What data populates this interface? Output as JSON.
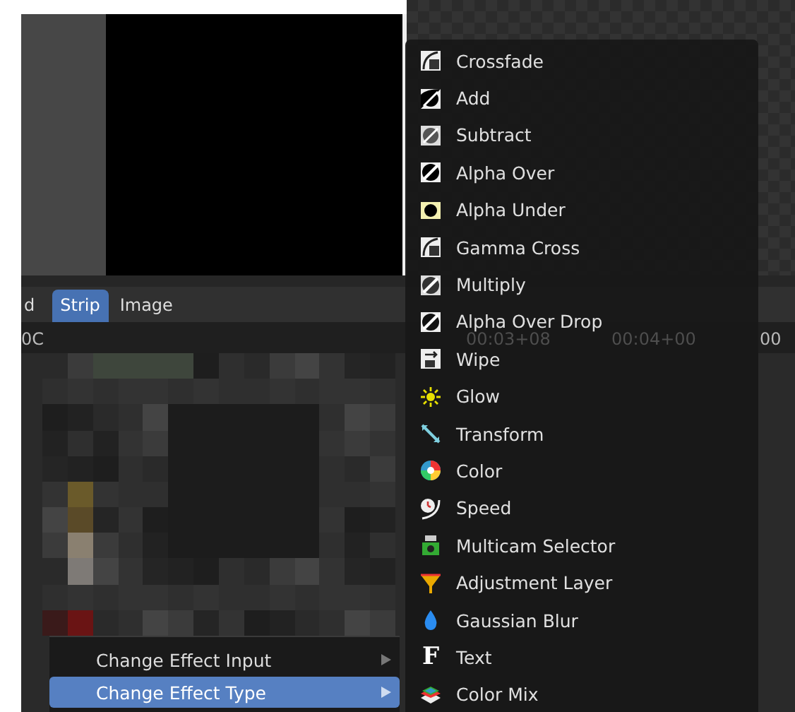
{
  "header": {
    "tabs": [
      {
        "label": "d",
        "selected": false
      },
      {
        "label": "Strip",
        "selected": true
      },
      {
        "label": "Image",
        "selected": false
      }
    ]
  },
  "timeline": {
    "ruler": [
      "0C",
      "00:03+08",
      "00:04+00",
      "00"
    ]
  },
  "context_menu": {
    "items": [
      {
        "label": "Change Effect Input",
        "selected": false
      },
      {
        "label": "Change Effect Type",
        "selected": true
      }
    ]
  },
  "submenu": {
    "items": [
      {
        "label": "Crossfade"
      },
      {
        "label": "Add"
      },
      {
        "label": "Subtract"
      },
      {
        "label": "Alpha Over"
      },
      {
        "label": "Alpha Under"
      },
      {
        "label": "Gamma Cross"
      },
      {
        "label": "Multiply"
      },
      {
        "label": "Alpha Over Drop"
      },
      {
        "label": "Wipe"
      },
      {
        "label": "Glow"
      },
      {
        "label": "Transform"
      },
      {
        "label": "Color"
      },
      {
        "label": "Speed"
      },
      {
        "label": "Multicam Selector"
      },
      {
        "label": "Adjustment Layer"
      },
      {
        "label": "Gaussian Blur"
      },
      {
        "label": "Text",
        "glyph": "F"
      },
      {
        "label": "Color Mix"
      }
    ]
  }
}
